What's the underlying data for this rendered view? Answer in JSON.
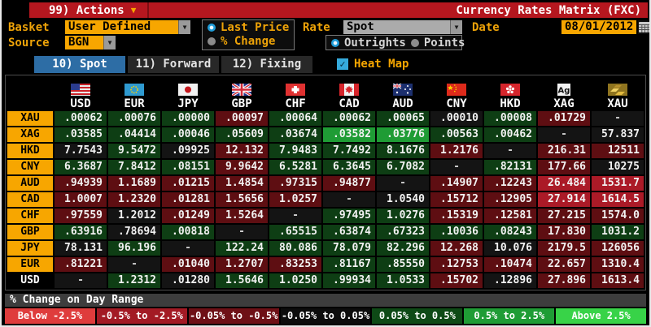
{
  "title_bar": {
    "actions_label": "99) Actions",
    "title": "Currency Rates Matrix (FXC)"
  },
  "controls": {
    "basket_label": "Basket",
    "basket_value": "User Defined",
    "source_label": "Source",
    "source_value": "BGN",
    "price_mode": {
      "options": [
        "Last Price",
        "% Change"
      ],
      "selected": "Last Price"
    },
    "rate_label": "Rate",
    "rate_value": "Spot",
    "rate_mode": {
      "options": [
        "Outrights",
        "Points"
      ],
      "selected": "Outrights"
    },
    "date_label": "Date",
    "date_value": "08/01/2012"
  },
  "tabs": [
    {
      "label": "10) Spot",
      "selected": true
    },
    {
      "label": "11) Forward",
      "selected": false
    },
    {
      "label": "12) Fixing",
      "selected": false
    }
  ],
  "heatmap_toggle": {
    "label": "Heat Map",
    "checked": true
  },
  "cell_colors": {
    "g": "#0e3e14",
    "G": "#1f9c35",
    "r": "#5e0e12",
    "R": "#ab1a27",
    "k": "#141414"
  },
  "table": {
    "columns": [
      {
        "code": "USD",
        "icon": "us-flag"
      },
      {
        "code": "EUR",
        "icon": "eu-flag"
      },
      {
        "code": "JPY",
        "icon": "japan-flag"
      },
      {
        "code": "GBP",
        "icon": "uk-flag"
      },
      {
        "code": "CHF",
        "icon": "switzerland-flag"
      },
      {
        "code": "CAD",
        "icon": "canada-flag"
      },
      {
        "code": "AUD",
        "icon": "australia-flag"
      },
      {
        "code": "CNY",
        "icon": "china-flag"
      },
      {
        "code": "HKD",
        "icon": "hongkong-flag"
      },
      {
        "code": "XAG",
        "icon": "silver"
      },
      {
        "code": "XAU",
        "icon": "gold"
      }
    ],
    "rows": [
      {
        "label": "XAU",
        "variant": "orange",
        "cells": [
          [
            ".00062",
            "g"
          ],
          [
            ".00076",
            "g"
          ],
          [
            ".00000",
            "g"
          ],
          [
            ".00097",
            "r"
          ],
          [
            ".00064",
            "g"
          ],
          [
            ".00062",
            "g"
          ],
          [
            ".00065",
            "g"
          ],
          [
            ".00010",
            "k"
          ],
          [
            ".00008",
            "g"
          ],
          [
            ".01729",
            "r"
          ],
          [
            "-",
            "k"
          ]
        ]
      },
      {
        "label": "XAG",
        "variant": "orange",
        "cells": [
          [
            ".03585",
            "g"
          ],
          [
            ".04414",
            "g"
          ],
          [
            ".00046",
            "g"
          ],
          [
            ".05609",
            "g"
          ],
          [
            ".03674",
            "g"
          ],
          [
            ".03582",
            "G"
          ],
          [
            ".03776",
            "G"
          ],
          [
            ".00563",
            "g"
          ],
          [
            ".00462",
            "g"
          ],
          [
            "-",
            "k"
          ],
          [
            "57.837",
            "k"
          ]
        ]
      },
      {
        "label": "HKD",
        "variant": "orange",
        "cells": [
          [
            "7.7543",
            "k"
          ],
          [
            "9.5472",
            "g"
          ],
          [
            ".09925",
            "k"
          ],
          [
            "12.132",
            "r"
          ],
          [
            "7.9483",
            "g"
          ],
          [
            "7.7492",
            "g"
          ],
          [
            "8.1676",
            "g"
          ],
          [
            "1.2176",
            "r"
          ],
          [
            "-",
            "k"
          ],
          [
            "216.31",
            "r"
          ],
          [
            "12511",
            "r"
          ]
        ]
      },
      {
        "label": "CNY",
        "variant": "orange",
        "cells": [
          [
            "6.3687",
            "g"
          ],
          [
            "7.8412",
            "g"
          ],
          [
            ".08151",
            "g"
          ],
          [
            "9.9642",
            "r"
          ],
          [
            "6.5281",
            "g"
          ],
          [
            "6.3645",
            "g"
          ],
          [
            "6.7082",
            "g"
          ],
          [
            "-",
            "k"
          ],
          [
            ".82131",
            "g"
          ],
          [
            "177.66",
            "r"
          ],
          [
            "10275",
            "k"
          ]
        ]
      },
      {
        "label": "AUD",
        "variant": "orange",
        "cells": [
          [
            ".94939",
            "r"
          ],
          [
            "1.1689",
            "r"
          ],
          [
            ".01215",
            "r"
          ],
          [
            "1.4854",
            "r"
          ],
          [
            ".97315",
            "r"
          ],
          [
            ".94877",
            "r"
          ],
          [
            "-",
            "k"
          ],
          [
            ".14907",
            "r"
          ],
          [
            ".12243",
            "r"
          ],
          [
            "26.484",
            "R"
          ],
          [
            "1531.7",
            "R"
          ]
        ]
      },
      {
        "label": "CAD",
        "variant": "orange",
        "cells": [
          [
            "1.0007",
            "r"
          ],
          [
            "1.2320",
            "r"
          ],
          [
            ".01281",
            "r"
          ],
          [
            "1.5656",
            "r"
          ],
          [
            "1.0257",
            "r"
          ],
          [
            "-",
            "k"
          ],
          [
            "1.0540",
            "k"
          ],
          [
            ".15712",
            "r"
          ],
          [
            ".12905",
            "r"
          ],
          [
            "27.914",
            "R"
          ],
          [
            "1614.5",
            "R"
          ]
        ]
      },
      {
        "label": "CHF",
        "variant": "orange",
        "cells": [
          [
            ".97559",
            "r"
          ],
          [
            "1.2012",
            "k"
          ],
          [
            ".01249",
            "r"
          ],
          [
            "1.5264",
            "r"
          ],
          [
            "-",
            "k"
          ],
          [
            ".97495",
            "g"
          ],
          [
            "1.0276",
            "g"
          ],
          [
            ".15319",
            "r"
          ],
          [
            ".12581",
            "r"
          ],
          [
            "27.215",
            "r"
          ],
          [
            "1574.0",
            "r"
          ]
        ]
      },
      {
        "label": "GBP",
        "variant": "orange",
        "cells": [
          [
            ".63916",
            "g"
          ],
          [
            ".78694",
            "k"
          ],
          [
            ".00818",
            "g"
          ],
          [
            "-",
            "k"
          ],
          [
            ".65515",
            "g"
          ],
          [
            ".63874",
            "g"
          ],
          [
            ".67323",
            "g"
          ],
          [
            ".10036",
            "g"
          ],
          [
            ".08243",
            "g"
          ],
          [
            "17.830",
            "r"
          ],
          [
            "1031.2",
            "g"
          ]
        ]
      },
      {
        "label": "JPY",
        "variant": "orange",
        "cells": [
          [
            "78.131",
            "k"
          ],
          [
            "96.196",
            "g"
          ],
          [
            "-",
            "k"
          ],
          [
            "122.24",
            "g"
          ],
          [
            "80.086",
            "g"
          ],
          [
            "78.079",
            "g"
          ],
          [
            "82.296",
            "g"
          ],
          [
            "12.268",
            "r"
          ],
          [
            "10.076",
            "k"
          ],
          [
            "2179.5",
            "r"
          ],
          [
            "126056",
            "r"
          ]
        ]
      },
      {
        "label": "EUR",
        "variant": "orange",
        "cells": [
          [
            ".81221",
            "r"
          ],
          [
            "-",
            "k"
          ],
          [
            ".01040",
            "r"
          ],
          [
            "1.2707",
            "r"
          ],
          [
            ".83253",
            "r"
          ],
          [
            ".81167",
            "g"
          ],
          [
            ".85550",
            "g"
          ],
          [
            ".12753",
            "r"
          ],
          [
            ".10474",
            "r"
          ],
          [
            "22.657",
            "r"
          ],
          [
            "1310.4",
            "r"
          ]
        ]
      },
      {
        "label": "USD",
        "variant": "plain",
        "cells": [
          [
            "-",
            "k"
          ],
          [
            "1.2312",
            "g"
          ],
          [
            ".01280",
            "k"
          ],
          [
            "1.5646",
            "g"
          ],
          [
            "1.0250",
            "g"
          ],
          [
            ".99934",
            "g"
          ],
          [
            "1.0533",
            "g"
          ],
          [
            ".15702",
            "r"
          ],
          [
            ".12896",
            "k"
          ],
          [
            "27.896",
            "r"
          ],
          [
            "1613.4",
            "r"
          ]
        ]
      }
    ]
  },
  "legend": {
    "title": "% Change on Day Range",
    "items": [
      {
        "label": "Below -2.5%",
        "color": "#df3c3c"
      },
      {
        "label": "-0.5% to -2.5%",
        "color": "#a31a24"
      },
      {
        "label": "-0.05% to -0.5%",
        "color": "#6e1016"
      },
      {
        "label": "-0.05% to 0.05%",
        "color": "#0c0c0c"
      },
      {
        "label": "0.05% to 0.5%",
        "color": "#0e4a16"
      },
      {
        "label": "0.5% to 2.5%",
        "color": "#1f9c35"
      },
      {
        "label": "Above 2.5%",
        "color": "#38d348"
      }
    ]
  }
}
